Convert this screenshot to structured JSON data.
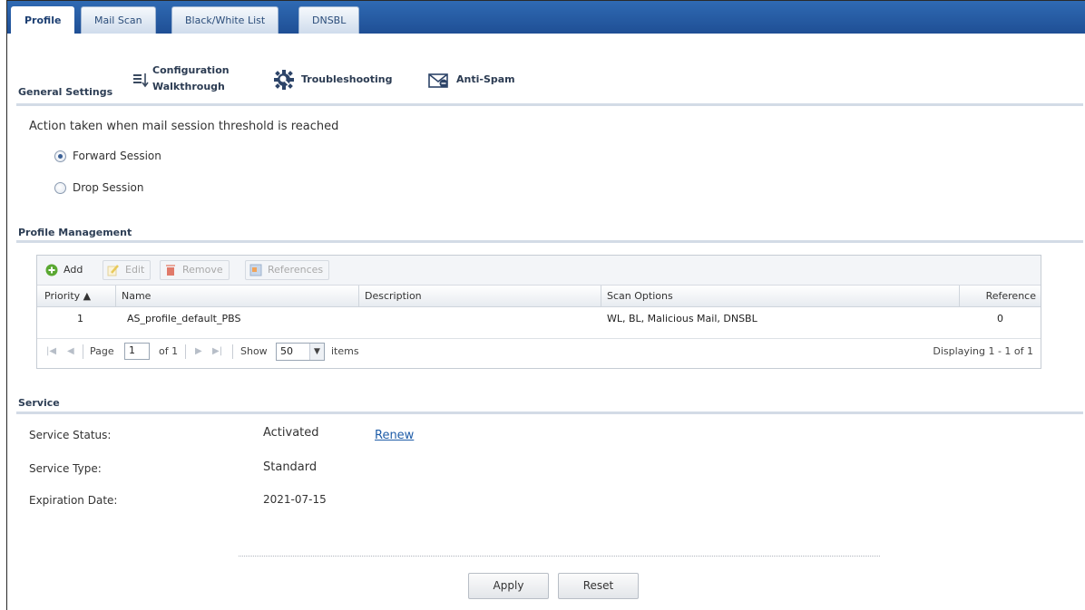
{
  "tabs": [
    {
      "label": "Profile",
      "active": true
    },
    {
      "label": "Mail Scan",
      "active": false
    },
    {
      "label": "Black/White List",
      "active": false
    },
    {
      "label": "DNSBL",
      "active": false
    }
  ],
  "general": {
    "title": "General Settings",
    "tools": {
      "config_line1": "Configuration",
      "config_line2": "Walkthrough",
      "troubleshooting": "Troubleshooting",
      "antispam": "Anti-Spam"
    },
    "action_text": "Action taken when mail session threshold is reached",
    "options": [
      {
        "label": "Forward Session",
        "checked": true
      },
      {
        "label": "Drop Session",
        "checked": false
      }
    ]
  },
  "profile_mgmt": {
    "title": "Profile Management",
    "toolbar": {
      "add": "Add",
      "edit": "Edit",
      "remove": "Remove",
      "references": "References"
    },
    "columns": [
      "Priority ▲",
      "Name",
      "Description",
      "Scan Options",
      "Reference"
    ],
    "rows": [
      {
        "priority": "1",
        "name": "AS_profile_default_PBS",
        "description": "",
        "scan_options": "WL, BL, Malicious Mail, DNSBL",
        "reference": "0"
      }
    ],
    "pager": {
      "page_label": "Page",
      "page_value": "1",
      "of_label": "of 1",
      "show_label": "Show",
      "show_value": "50",
      "items_label": "items",
      "display_text": "Displaying 1 - 1 of 1"
    }
  },
  "service": {
    "title": "Service",
    "status_label": "Service Status:",
    "status_value": "Activated",
    "renew": "Renew",
    "type_label": "Service Type:",
    "type_value": "Standard",
    "expiry_label": "Expiration Date:",
    "expiry_value": "2021-07-15"
  },
  "footer": {
    "apply": "Apply",
    "reset": "Reset"
  },
  "colors": {
    "tabbar": "#2a5fa8",
    "link": "#1f5da8",
    "add_icon": "#5aa832",
    "remove_icon": "#e07a6a"
  }
}
